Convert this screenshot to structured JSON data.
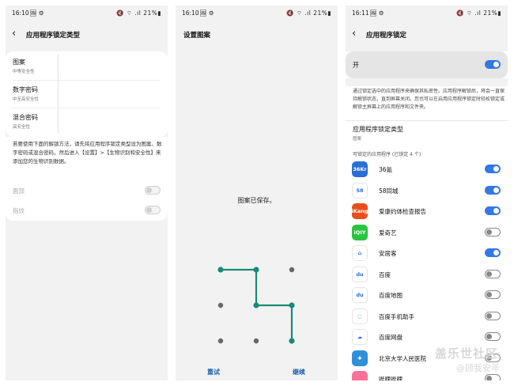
{
  "screen1": {
    "status": {
      "time": "16:10",
      "icons": "🖼 ⚙",
      "right": "🔇 ⌔ .ıl 21%▮"
    },
    "title": "应用程序锁定类型",
    "options": [
      {
        "label": "图案",
        "sub": "中等安全性"
      },
      {
        "label": "数字密码",
        "sub": "中至高安全性"
      },
      {
        "label": "混合密码",
        "sub": "高安全性"
      }
    ],
    "biometric_note": "若要使用下面的解锁方法，请先将应用程序锁定类型设为图案、数字密码或混合密码，然后进入【设置】>【生物识别和安全性】来添加您的生物识别数据。",
    "biometrics": [
      {
        "label": "面部"
      },
      {
        "label": "指纹"
      }
    ]
  },
  "screen2": {
    "status": {
      "time": "16:10",
      "icons": "🖼 ⚙",
      "right": "🔇 ⌔ .ıl 21%▮"
    },
    "title": "设置图案",
    "message": "图案已保存。",
    "retry": "重试",
    "continue": "继续",
    "pattern_sequence": [
      1,
      2,
      5,
      6,
      9
    ],
    "colors": {
      "pattern": "#1a8a78",
      "dot": "#666666"
    }
  },
  "screen3": {
    "status": {
      "time": "16:11",
      "icons": "🖼 ⚙",
      "right": "🔇 ⌔ .ıl 21%▮"
    },
    "title": "应用程序锁定",
    "master_label": "开",
    "description": "通过锁定选中的应用程序来确保其私密性。应用程序解锁后，将会一直保持解锁状态，直到屏幕关闭。您也可以在启用应用程序锁定时轻松锁定或解锁主屏幕上的应用程序和文件夹。",
    "lock_type_label": "应用程序锁定类型",
    "lock_type_value": "图案",
    "section_header": "可锁定的应用程序 (已锁定 4 个)",
    "apps": [
      {
        "name": "36氪",
        "on": true,
        "icon": "36Kr",
        "color": "#2a6fd6"
      },
      {
        "name": "58同城",
        "on": true,
        "icon": "58",
        "color": "#ffffff"
      },
      {
        "name": "爱康约体检查报告",
        "on": true,
        "icon": "iKang",
        "color": "#e84e1b"
      },
      {
        "name": "爱奇艺",
        "on": false,
        "icon": "iQIY",
        "color": "#2bc440"
      },
      {
        "name": "安居客",
        "on": true,
        "icon": "⌂",
        "color": "#ffffff"
      },
      {
        "name": "百度",
        "on": false,
        "icon": "du",
        "color": "#ffffff"
      },
      {
        "name": "百度地图",
        "on": false,
        "icon": "du",
        "color": "#ffffff"
      },
      {
        "name": "百度手机助手",
        "on": false,
        "icon": "◌",
        "color": "#ffffff"
      },
      {
        "name": "百度网盘",
        "on": false,
        "icon": "☁",
        "color": "#ffffff"
      },
      {
        "name": "北京大学人民医院",
        "on": false,
        "icon": "✚",
        "color": "#2f8fd8"
      },
      {
        "name": "哔哩哔哩",
        "on": false,
        "icon": "",
        "color": "#fb7299"
      }
    ],
    "watermark_line1": "盖乐世社区",
    "watermark_line2": "@顾我安年"
  },
  "colors": {
    "accent": "#3478e6",
    "toggle_off": "#888888"
  }
}
